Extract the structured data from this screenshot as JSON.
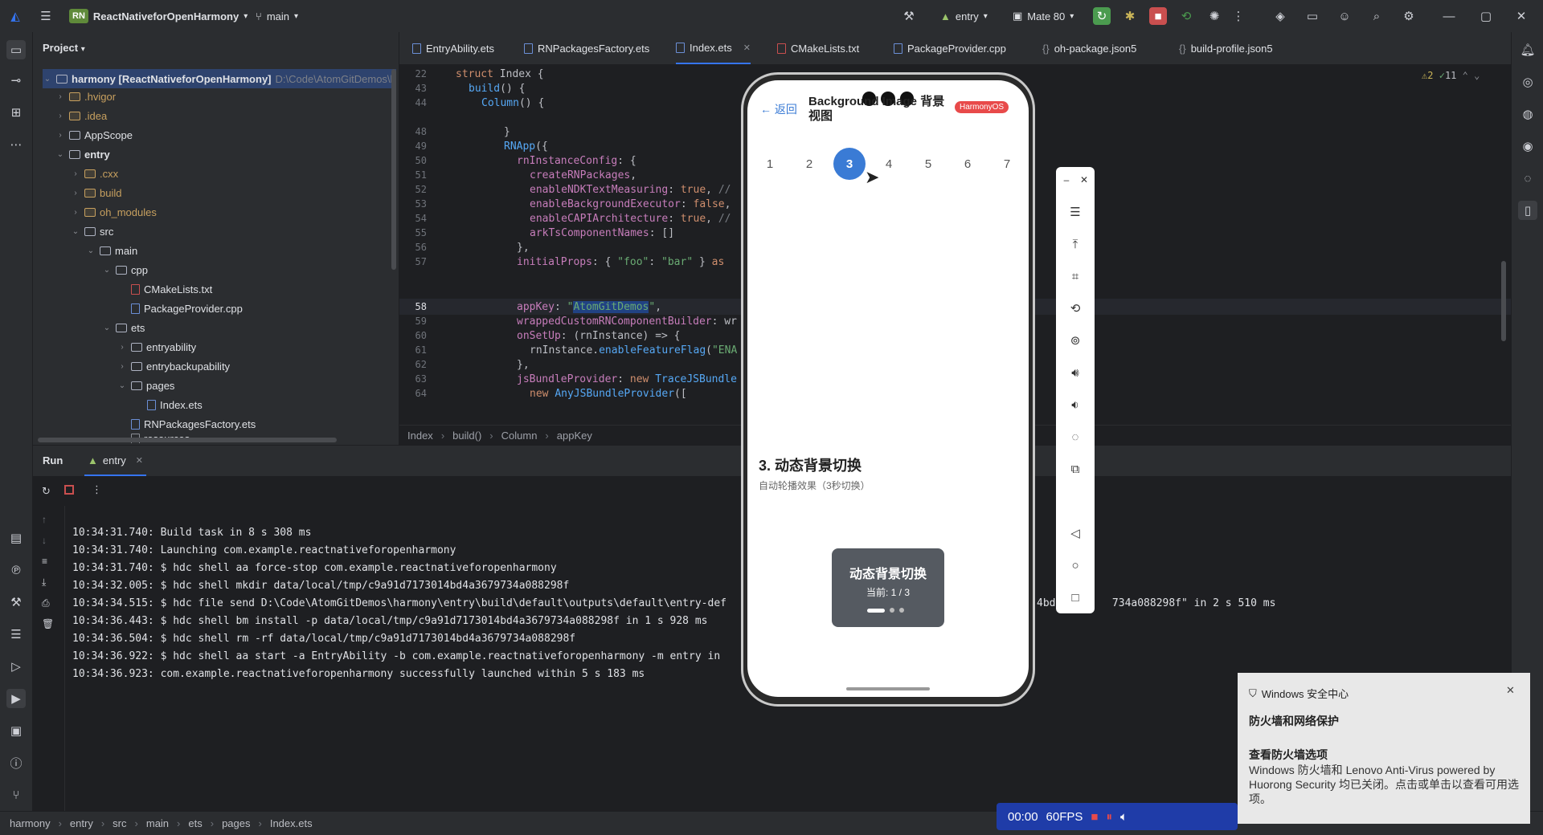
{
  "titlebar": {
    "project_badge": "RN",
    "project_name": "ReactNativeforOpenHarmony",
    "branch": "main",
    "run_config": "entry",
    "device": "Mate 80"
  },
  "project_panel": {
    "title": "Project",
    "root": "harmony [ReactNativeforOpenHarmony]",
    "root_path": "D:\\Code\\AtomGitDemos\\h",
    "items": [
      {
        "label": ".hvigor"
      },
      {
        "label": ".idea"
      },
      {
        "label": "AppScope"
      },
      {
        "label": "entry"
      },
      {
        "label": ".cxx"
      },
      {
        "label": "build"
      },
      {
        "label": "oh_modules"
      },
      {
        "label": "src"
      },
      {
        "label": "main"
      },
      {
        "label": "cpp"
      },
      {
        "label": "CMakeLists.txt"
      },
      {
        "label": "PackageProvider.cpp"
      },
      {
        "label": "ets"
      },
      {
        "label": "entryability"
      },
      {
        "label": "entrybackupability"
      },
      {
        "label": "pages"
      },
      {
        "label": "Index.ets"
      },
      {
        "label": "RNPackagesFactory.ets"
      },
      {
        "label": "resources"
      }
    ]
  },
  "tabs": [
    {
      "label": "EntryAbility.ets"
    },
    {
      "label": "RNPackagesFactory.ets"
    },
    {
      "label": "Index.ets"
    },
    {
      "label": "CMakeLists.txt"
    },
    {
      "label": "PackageProvider.cpp"
    },
    {
      "label": "oh-package.json5"
    },
    {
      "label": "build-profile.json5"
    }
  ],
  "editor": {
    "warnings": "2",
    "checks": "11",
    "line_numbers": [
      "22",
      "43",
      "44",
      "48",
      "49",
      "50",
      "51",
      "52",
      "53",
      "54",
      "55",
      "56",
      "57",
      "58",
      "59",
      "60",
      "61",
      "62",
      "63",
      "64"
    ]
  },
  "breadcrumb": [
    "Index",
    "build()",
    "Column",
    "appKey"
  ],
  "run_panel": {
    "title": "Run",
    "tab": "entry",
    "log": [
      "10:34:31.740: Build task in 8 s 308 ms",
      "10:34:31.740: Launching com.example.reactnativeforopenharmony",
      "10:34:31.740: $ hdc shell aa force-stop com.example.reactnativeforopenharmony",
      "10:34:32.005: $ hdc shell mkdir data/local/tmp/c9a91d7173014bd4a3679734a088298f",
      "10:34:34.515: $ hdc file send D:\\Code\\AtomGitDemos\\harmony\\entry\\build\\default\\outputs\\default\\entry-def",
      "10:34:36.443: $ hdc shell bm install -p data/local/tmp/c9a91d7173014bd4a3679734a088298f in 1 s 928 ms",
      "10:34:36.504: $ hdc shell rm -rf data/local/tmp/c9a91d7173014bd4a3679734a088298f",
      "10:34:36.922: $ hdc shell aa start -a EntryAbility -b com.example.reactnativeforopenharmony -m entry in",
      "10:34:36.923: com.example.reactnativeforopenharmony successfully launched within 5 s 183 ms"
    ],
    "log_tail": "4bd         734a088298f\" in 2 s 510 ms"
  },
  "statusbar": [
    "harmony",
    "entry",
    "src",
    "main",
    "ets",
    "pages",
    "Index.ets"
  ],
  "phone": {
    "back_label": "← 返回",
    "header_title_1": "Background Image 背景",
    "header_title_2": "视图",
    "badge": "HarmonyOS",
    "pages": [
      "1",
      "2",
      "3",
      "4",
      "5",
      "6",
      "7"
    ],
    "active_page": "3",
    "section_title": "3. 动态背景切换",
    "section_subtitle": "自动轮播效果（3秒切换）",
    "card_title": "动态背景切换",
    "card_current": "当前: 1 / 3",
    "accent": "#3a7bd5"
  },
  "recorder": {
    "time": "00:00",
    "fps": "60FPS"
  },
  "notification": {
    "app": "Windows 安全中心",
    "heading": "防火墙和网络保护",
    "subheading": "查看防火墙选项",
    "body": "Windows 防火墙和 Lenovo Anti-Virus powered by Huorong Security 均已关闭。点击或单击以查看可用选项。"
  }
}
